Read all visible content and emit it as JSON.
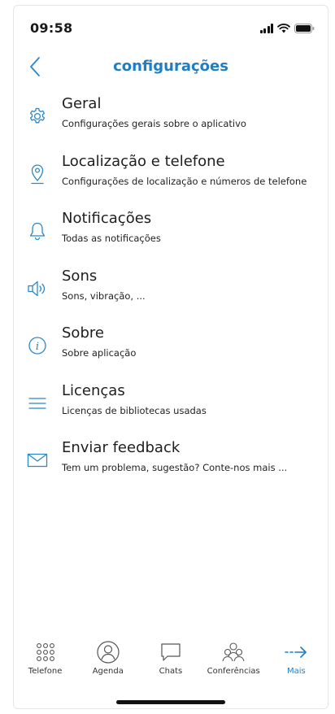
{
  "status_bar": {
    "time": "09:58"
  },
  "header": {
    "title": "configurações",
    "back_icon": "chevron-left-icon"
  },
  "colors": {
    "accent": "#1f7ec4",
    "icon": "#2a87c9",
    "text": "#1e1e1e"
  },
  "settings": [
    {
      "icon": "gear-icon",
      "title": "Geral",
      "subtitle": "Configurações gerais sobre o aplicativo"
    },
    {
      "icon": "location-pin-icon",
      "title": "Localização e telefone",
      "subtitle": "Configurações de localização e números de telefone"
    },
    {
      "icon": "bell-icon",
      "title": "Notificações",
      "subtitle": "Todas as notificações"
    },
    {
      "icon": "speaker-icon",
      "title": "Sons",
      "subtitle": "Sons, vibração, ..."
    },
    {
      "icon": "info-icon",
      "title": "Sobre",
      "subtitle": "Sobre aplicação"
    },
    {
      "icon": "list-lines-icon",
      "title": "Licenças",
      "subtitle": "Licenças de bibliotecas usadas"
    },
    {
      "icon": "envelope-icon",
      "title": "Enviar feedback",
      "subtitle": "Tem um problema, sugestão? Conte-nos mais ..."
    }
  ],
  "tab_bar": {
    "active": "Mais",
    "tabs": [
      {
        "icon": "dialpad-icon",
        "label": "Telefone"
      },
      {
        "icon": "contact-icon",
        "label": "Agenda"
      },
      {
        "icon": "chat-bubble-icon",
        "label": "Chats"
      },
      {
        "icon": "group-icon",
        "label": "Conferências"
      },
      {
        "icon": "arrow-right-icon",
        "label": "Mais"
      }
    ]
  }
}
